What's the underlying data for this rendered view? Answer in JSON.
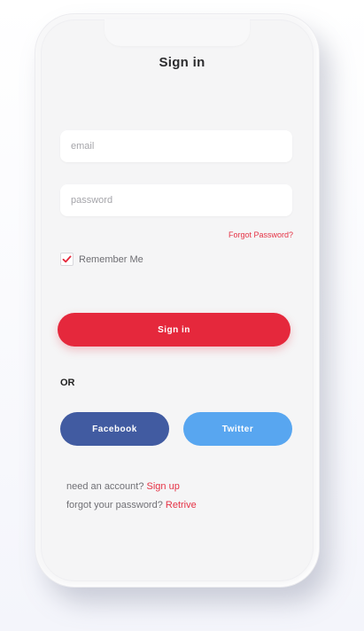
{
  "title": "Sign in",
  "form": {
    "email_placeholder": "email",
    "password_placeholder": "password",
    "forgot_password": "Forgot Password?",
    "remember_me": "Remember Me",
    "remember_checked": true,
    "signin_label": "Sign in"
  },
  "divider": "OR",
  "social": {
    "facebook_label": "Facebook",
    "twitter_label": "Twitter"
  },
  "footer": {
    "signup_prompt": "need an account?",
    "signup_link": "Sign up",
    "retrieve_prompt": "forgot your password?",
    "retrieve_link": "Retrive"
  },
  "icons": {
    "checkbox_mark": "check-icon"
  },
  "colors": {
    "accent_red": "#e5283c",
    "facebook_blue": "#415ba1",
    "twitter_blue": "#58a6f0"
  }
}
